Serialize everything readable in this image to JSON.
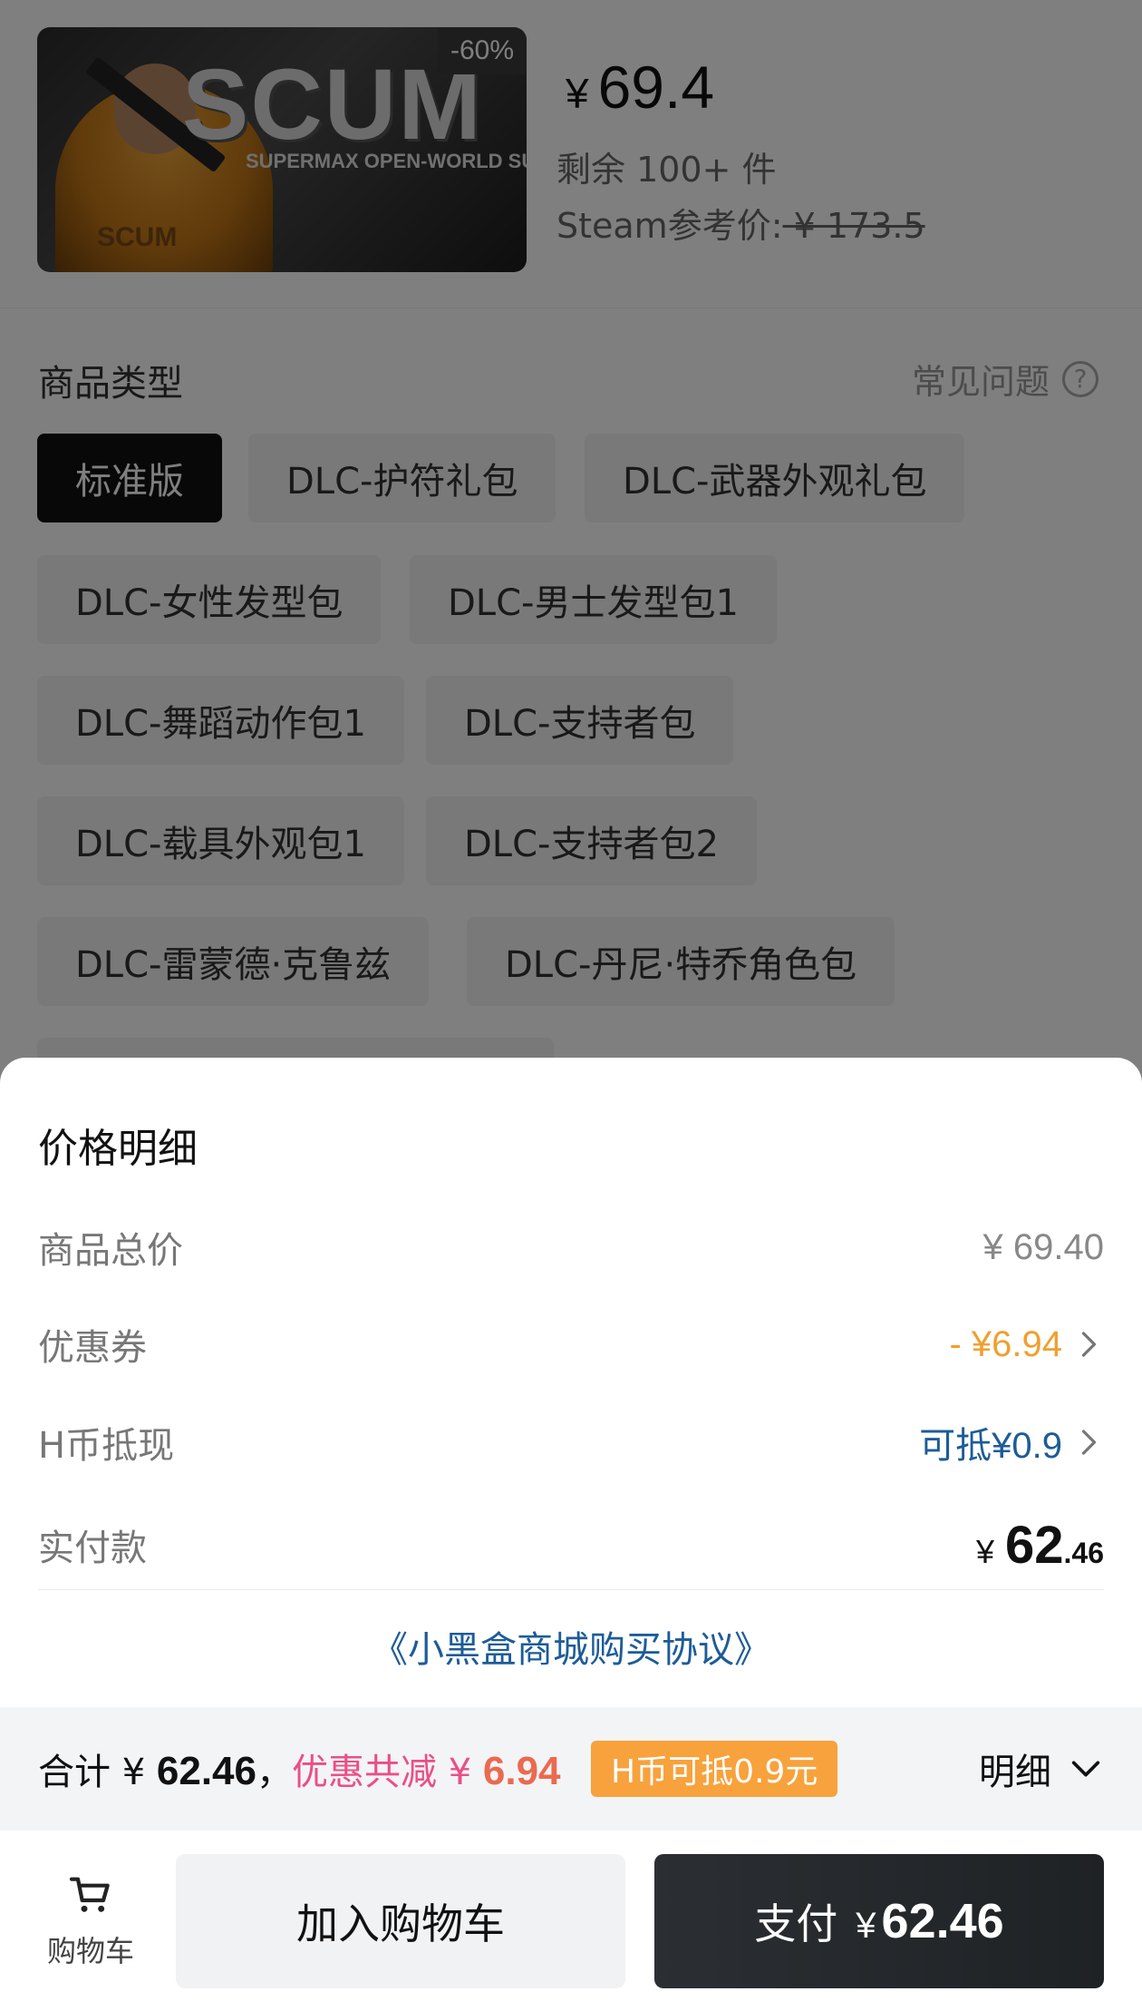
{
  "product": {
    "cover_logo": "SCUM",
    "cover_subtitle": "SUPERMAX OPEN-WORLD SURVIVA",
    "cover_shirt_text": "SCUM",
    "discount": "-60%",
    "currency": "¥",
    "price": "69.4",
    "stock": "剩余 100+ 件",
    "ref_label": "Steam参考价:",
    "ref_price": " ¥ 173.5"
  },
  "types": {
    "title": "商品类型",
    "faq_label": "常见问题",
    "faq_icon": "?",
    "options": [
      "标准版",
      "DLC-护符礼包",
      "DLC-武器外观礼包",
      "DLC-女性发型包",
      "DLC-男士发型包1",
      "DLC-舞蹈动作包1",
      "DLC-支持者包",
      "DLC-载具外观包1",
      "DLC-支持者包2",
      "DLC-雷蒙德·克鲁兹",
      "DLC-丹尼·特乔角色包"
    ]
  },
  "price_detail": {
    "title": "价格明细",
    "rows": {
      "total": {
        "label": "商品总价",
        "value": "¥ 69.40"
      },
      "coupon": {
        "label": "优惠券",
        "value": "- ¥6.94"
      },
      "hcoin": {
        "label": "H币抵现",
        "value": "可抵¥0.9"
      },
      "paid": {
        "label": "实付款",
        "yen": "¥",
        "int": "62",
        "dec": ".46"
      }
    },
    "agreement": "《小黑盒商城购买协议》"
  },
  "summary": {
    "total_prefix": "合计 ¥ ",
    "total_value": "62.46",
    "total_suffix": "，",
    "discount_prefix": "优惠共减 ¥ ",
    "discount_value": "6.94",
    "coin_badge": "H币可抵0.9元",
    "detail_label": "明细"
  },
  "actions": {
    "cart_label": "购物车",
    "add_to_cart": "加入购物车",
    "pay_label": "支付",
    "pay_yen": "¥",
    "pay_amount": "62.46"
  },
  "colors": {
    "accent_orange": "#f0a030",
    "link_blue": "#1d5c97",
    "discount_pink": "#ea4f86",
    "badge_orange": "#f7a23c",
    "pay_button": "#2b2f33"
  }
}
